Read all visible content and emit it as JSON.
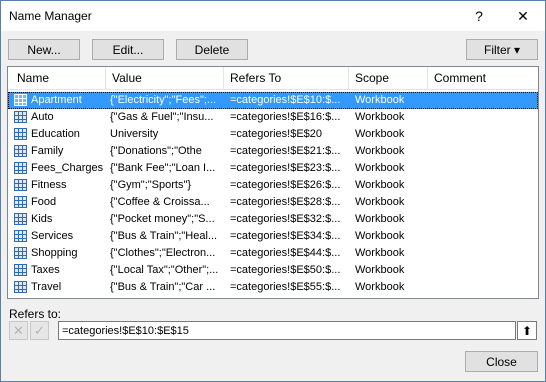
{
  "window": {
    "title": "Name Manager",
    "help": "?",
    "close": "✕"
  },
  "toolbar": {
    "new_label": "New...",
    "edit_label": "Edit...",
    "delete_label": "Delete",
    "filter_label": "Filter ▾"
  },
  "table": {
    "headers": [
      "Name",
      "Value",
      "Refers To",
      "Scope",
      "Comment"
    ],
    "rows": [
      {
        "name": "Apartment",
        "value": "{\"Electricity\";\"Fees\";...",
        "refers": "=categories!$E$10:$...",
        "scope": "Workbook",
        "comment": ""
      },
      {
        "name": "Auto",
        "value": "{\"Gas & Fuel\";\"Insu...",
        "refers": "=categories!$E$16:$...",
        "scope": "Workbook",
        "comment": ""
      },
      {
        "name": "Education",
        "value": "University",
        "refers": "=categories!$E$20",
        "scope": "Workbook",
        "comment": ""
      },
      {
        "name": "Family",
        "value": "{\"Donations\";\"Othe",
        "refers": "=categories!$E$21:$...",
        "scope": "Workbook",
        "comment": ""
      },
      {
        "name": "Fees_Charges",
        "value": "{\"Bank Fee\";\"Loan I...",
        "refers": "=categories!$E$23:$...",
        "scope": "Workbook",
        "comment": ""
      },
      {
        "name": "Fitness",
        "value": "{\"Gym\";\"Sports\"}",
        "refers": "=categories!$E$26:$...",
        "scope": "Workbook",
        "comment": ""
      },
      {
        "name": "Food",
        "value": "{\"Coffee & Croissa...",
        "refers": "=categories!$E$28:$...",
        "scope": "Workbook",
        "comment": ""
      },
      {
        "name": "Kids",
        "value": "{\"Pocket money\";\"S...",
        "refers": "=categories!$E$32:$...",
        "scope": "Workbook",
        "comment": ""
      },
      {
        "name": "Services",
        "value": "{\"Bus & Train\";\"Heal...",
        "refers": "=categories!$E$34:$...",
        "scope": "Workbook",
        "comment": ""
      },
      {
        "name": "Shopping",
        "value": "{\"Clothes\";\"Electron...",
        "refers": "=categories!$E$44:$...",
        "scope": "Workbook",
        "comment": ""
      },
      {
        "name": "Taxes",
        "value": "{\"Local Tax\";\"Other\";...",
        "refers": "=categories!$E$50:$...",
        "scope": "Workbook",
        "comment": ""
      },
      {
        "name": "Travel",
        "value": "{\"Bus & Train\";\"Car ...",
        "refers": "=categories!$E$55:$...",
        "scope": "Workbook",
        "comment": ""
      }
    ]
  },
  "refers_to": {
    "label": "Refers to:",
    "value": "=categories!$E$10:$E$15",
    "cancel_icon": "✕",
    "confirm_icon": "✓",
    "collapse_icon": "⬆"
  },
  "footer": {
    "close_label": "Close"
  },
  "colors": {
    "selection": "#3399ff",
    "icon": "#2a6db5"
  }
}
